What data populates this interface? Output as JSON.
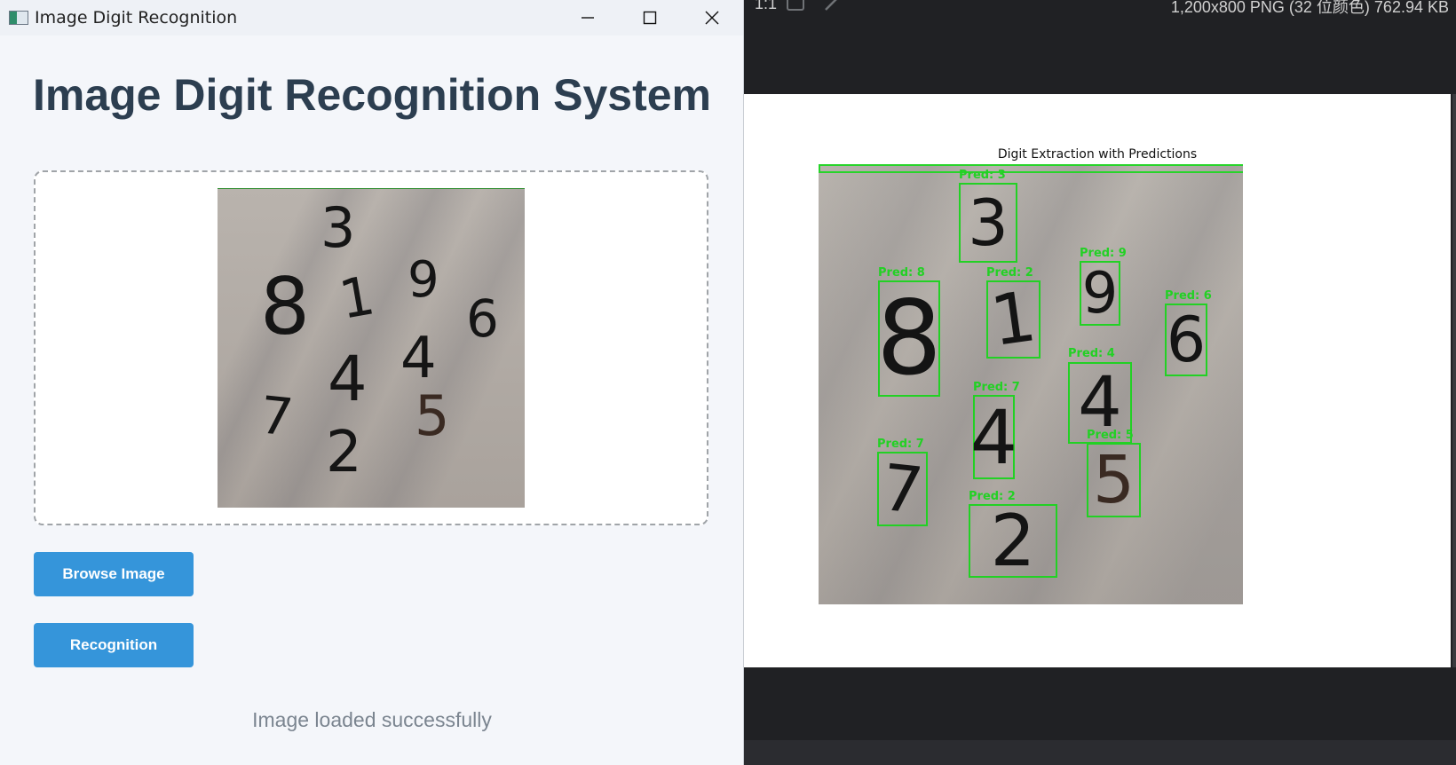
{
  "window": {
    "title": "Image Digit Recognition",
    "controls": [
      "minimize",
      "maximize",
      "close"
    ]
  },
  "app": {
    "heading": "Image Digit Recognition System",
    "browse_label": "Browse Image",
    "recognition_label": "Recognition",
    "status": "Image loaded successfully",
    "accent_color": "#3595da",
    "preview_digits": [
      "3",
      "8",
      "1",
      "9",
      "6",
      "4",
      "4",
      "7",
      "5",
      "2"
    ]
  },
  "viewer": {
    "zoom": "1:1",
    "file_info": "1,200x800 PNG (32 位颜色) 762.94 KB",
    "figure_title": "Digit Extraction with Predictions",
    "detections": [
      {
        "label": "Pred: 3",
        "digit": "3"
      },
      {
        "label": "Pred: 8",
        "digit": "8"
      },
      {
        "label": "Pred: 2",
        "digit": "1"
      },
      {
        "label": "Pred: 9",
        "digit": "9"
      },
      {
        "label": "Pred: 6",
        "digit": "6"
      },
      {
        "label": "Pred: 4",
        "digit": "4"
      },
      {
        "label": "Pred: 7",
        "digit": "4"
      },
      {
        "label": "Pred: 5",
        "digit": "5"
      },
      {
        "label": "Pred: 7",
        "digit": "7"
      },
      {
        "label": "Pred: 2",
        "digit": "2"
      }
    ],
    "box_color": "#22d124"
  }
}
